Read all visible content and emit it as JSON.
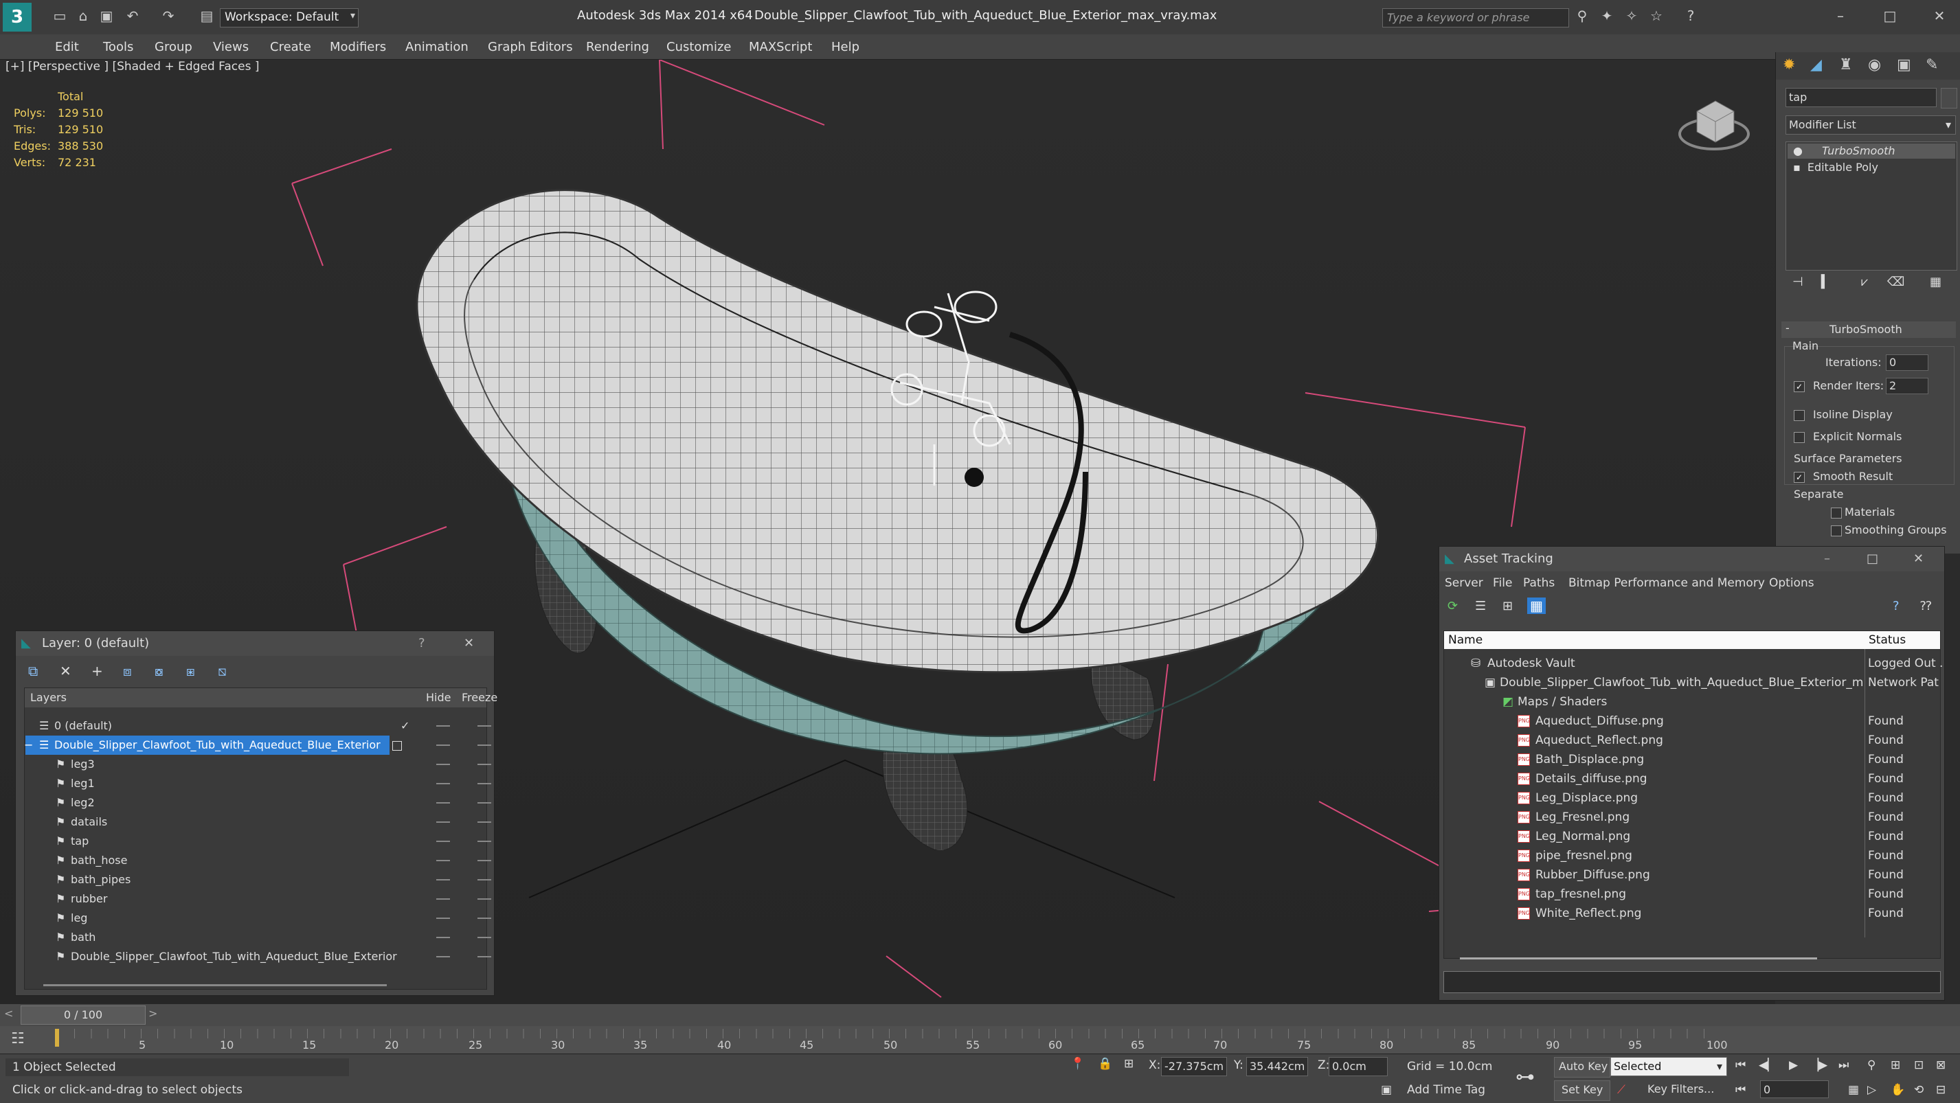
{
  "titlebar": {
    "app_title": "Autodesk 3ds Max  2014 x64",
    "file_title": "Double_Slipper_Clawfoot_Tub_with_Aqueduct_Blue_Exterior_max_vray.max",
    "workspace_label": "Workspace: Default",
    "search_placeholder": "Type a keyword or phrase"
  },
  "menu": [
    "Edit",
    "Tools",
    "Group",
    "Views",
    "Create",
    "Modifiers",
    "Animation",
    "Graph Editors",
    "Rendering",
    "Customize",
    "MAXScript",
    "Help"
  ],
  "viewport": {
    "label": "[+] [Perspective ] [Shaded + Edged Faces ]",
    "stats": {
      "total_label": "Total",
      "rows": [
        {
          "label": "Polys:",
          "value": "129 510"
        },
        {
          "label": "Tris:",
          "value": "129 510"
        },
        {
          "label": "Edges:",
          "value": "388 530"
        },
        {
          "label": "Verts:",
          "value": "72 231"
        }
      ]
    }
  },
  "command_panel": {
    "name_field": "tap",
    "modifier_list_label": "Modifier List",
    "stack": [
      "TurboSmooth",
      "Editable Poly"
    ],
    "rollout_title": "TurboSmooth",
    "main_label": "Main",
    "iterations_label": "Iterations:",
    "iterations_value": "0",
    "render_iters_label": "Render Iters:",
    "render_iters_value": "2",
    "isoline_label": "Isoline Display",
    "explicit_normals_label": "Explicit Normals",
    "surface_params_label": "Surface Parameters",
    "smooth_result_label": "Smooth Result",
    "separate_label": "Separate",
    "materials_label": "Materials",
    "smoothing_groups_label": "Smoothing Groups"
  },
  "layer_dialog": {
    "title": "Layer: 0 (default)",
    "help": "?",
    "col_layers": "Layers",
    "col_hide": "Hide",
    "col_freeze": "Freeze",
    "rows": [
      {
        "name": "0 (default)"
      },
      {
        "name": "Double_Slipper_Clawfoot_Tub_with_Aqueduct_Blue_Exterior"
      },
      {
        "name": "leg3"
      },
      {
        "name": "leg1"
      },
      {
        "name": "leg2"
      },
      {
        "name": "datails"
      },
      {
        "name": "tap"
      },
      {
        "name": "bath_hose"
      },
      {
        "name": "bath_pipes"
      },
      {
        "name": "rubber"
      },
      {
        "name": "leg"
      },
      {
        "name": "bath"
      },
      {
        "name": "Double_Slipper_Clawfoot_Tub_with_Aqueduct_Blue_Exterior"
      }
    ]
  },
  "asset_dialog": {
    "title": "Asset Tracking",
    "menu": [
      "Server",
      "File",
      "Paths",
      "Bitmap Performance and Memory",
      "Options"
    ],
    "col_name": "Name",
    "col_status": "Status",
    "rows": [
      {
        "name": "Autodesk Vault",
        "status": "Logged Out ."
      },
      {
        "name": "Double_Slipper_Clawfoot_Tub_with_Aqueduct_Blue_Exterior_ma...",
        "status": "Network Path"
      },
      {
        "name": "Maps / Shaders",
        "status": ""
      },
      {
        "name": "Aqueduct_Diffuse.png",
        "status": "Found"
      },
      {
        "name": "Aqueduct_Reflect.png",
        "status": "Found"
      },
      {
        "name": "Bath_Displace.png",
        "status": "Found"
      },
      {
        "name": "Details_diffuse.png",
        "status": "Found"
      },
      {
        "name": "Leg_Displace.png",
        "status": "Found"
      },
      {
        "name": "Leg_Fresnel.png",
        "status": "Found"
      },
      {
        "name": "Leg_Normal.png",
        "status": "Found"
      },
      {
        "name": "pipe_fresnel.png",
        "status": "Found"
      },
      {
        "name": "Rubber_Diffuse.png",
        "status": "Found"
      },
      {
        "name": "tap_fresnel.png",
        "status": "Found"
      },
      {
        "name": "White_Reflect.png",
        "status": "Found"
      }
    ]
  },
  "timeline": {
    "frame_label": "0 / 100",
    "ticks": [
      "0",
      "5",
      "10",
      "15",
      "20",
      "25",
      "30",
      "35",
      "40",
      "45",
      "50",
      "55",
      "60",
      "65",
      "70",
      "75",
      "80",
      "85",
      "90",
      "95",
      "100"
    ]
  },
  "status": {
    "selection": "1 Object Selected",
    "prompt": "Click or click-and-drag to select objects",
    "x_value": "-27.375cm",
    "y_value": "35.442cm",
    "z_value": "0.0cm",
    "grid": "Grid = 10.0cm",
    "add_time_tag": "Add Time Tag",
    "auto_key": "Auto Key",
    "set_key": "Set Key",
    "selected_dropdown": "Selected",
    "key_filters": "Key Filters...",
    "frame_field": "0"
  }
}
